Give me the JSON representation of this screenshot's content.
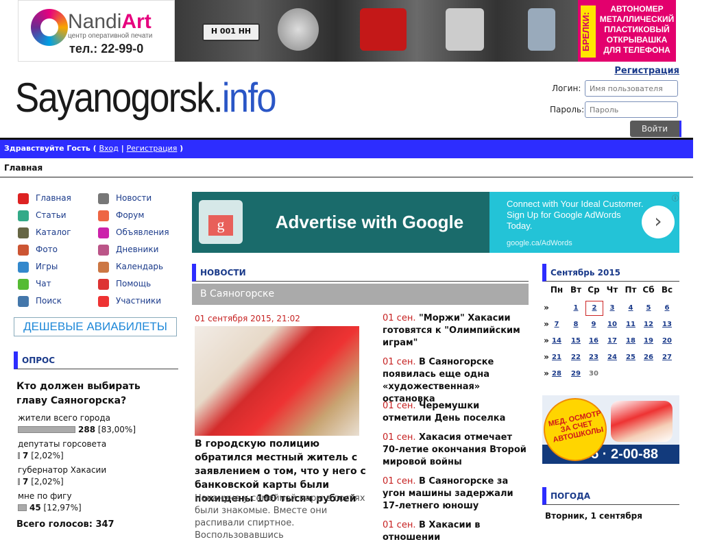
{
  "banner": {
    "brand_name": "Nandi",
    "brand_name_accent": "Art",
    "brand_sub": "центр оперативной печати",
    "brand_tel": "тел.: 22-99-0",
    "plate_text": "Н 001 НН",
    "side_word": "БРЕЛКИ:",
    "side_text": "АВТОНОМЕР МЕТАЛЛИЧЕСКИЙ ПЛАСТИКОВЫЙ ОТКРЫВАШКА ДЛЯ ТЕЛЕФОНА"
  },
  "header": {
    "logo_main": "Sayanogorsk.",
    "logo_accent": "info",
    "register_link": "Регистрация",
    "login_label": "Логин:",
    "login_placeholder": "Имя пользователя",
    "password_label": "Пароль:",
    "password_placeholder": "Пароль",
    "login_button": "Войти"
  },
  "bluebar": {
    "greeting": "Здравствуйте Гость",
    "open_paren": " ( ",
    "login_link": "Вход",
    "sep": " | ",
    "register_link": "Регистрация",
    "close_paren": " )"
  },
  "breadcrumb": "Главная",
  "menu": {
    "left": [
      "Главная",
      "Статьи",
      "Каталог",
      "Фото",
      "Игры",
      "Чат",
      "Поиск"
    ],
    "right": [
      "Новости",
      "Форум",
      "Объявления",
      "Дневники",
      "Календарь",
      "Помощь",
      "Участники"
    ],
    "left_colors": [
      "#d22",
      "#3a8",
      "#664",
      "#c53",
      "#38c",
      "#5b3",
      "#47a"
    ],
    "right_colors": [
      "#777",
      "#e64",
      "#c2a",
      "#b58",
      "#c74",
      "#d33",
      "#e33"
    ]
  },
  "cheap_flights": "ДЕШЕВЫЕ АВИАБИЛЕТЫ",
  "poll": {
    "heading": "ОПРОС",
    "question": "Кто должен выбирать главу Саяногорска?",
    "options": [
      {
        "label": "жители всего города",
        "count": "288",
        "percent": "[83,00%]",
        "share": 0.83
      },
      {
        "label": "депутаты горсовета",
        "count": "7",
        "percent": "[2,02%]",
        "share": 0.0202
      },
      {
        "label": "губернатор Хакасии",
        "count": "7",
        "percent": "[2,02%]",
        "share": 0.0202
      },
      {
        "label": "мне по фигу",
        "count": "45",
        "percent": "[12,97%]",
        "share": 0.1297
      }
    ],
    "total": "Всего голосов: 347"
  },
  "ad": {
    "icon_letter": "g",
    "headline": "Advertise with Google",
    "text": "Connect with Your Ideal Customer. Sign Up for Google AdWords Today.",
    "url": "google.ca/AdWords",
    "arrow": "›",
    "info": "ⓘ"
  },
  "news": {
    "heading": "НОВОСТИ",
    "subheading": "В Саяногорске",
    "lead_date": "01 сентября 2015, 21:02",
    "lead_title": "В городскую полицию обратился местный житель с заявлением о том, что у него с банковской карты были похищены 100 тысяч рублей",
    "lead_excerpt": "Накануне у семейной пары в гостях были знакомые. Вместе они распивали спиртное. Воспользовавшись",
    "items": [
      {
        "date": "01 сен.",
        "title": "\"Моржи\" Хакасии готовятся к \"Олимпийским играм\""
      },
      {
        "date": "01 сен.",
        "title": "В Саяногорске появилась еще одна «художественная» остановка"
      },
      {
        "date": "01 сен.",
        "title": "Черемушки отметили День поселка"
      },
      {
        "date": "01 сен.",
        "title": "Хакасия отмечает 70-летие окончания Второй мировой войны"
      },
      {
        "date": "01 сен.",
        "title": "В Саяногорске за угон машины задержали 17-летнего юношу"
      },
      {
        "date": "01 сен.",
        "title": "В Хакасии в отношении"
      }
    ]
  },
  "calendar": {
    "title": "Сентябрь 2015",
    "weekdays": [
      "Пн",
      "Вт",
      "Ср",
      "Чт",
      "Пт",
      "Сб",
      "Вс"
    ],
    "week_marker": "»",
    "weeks": [
      [
        "",
        "1",
        "2",
        "3",
        "4",
        "5",
        "6"
      ],
      [
        "7",
        "8",
        "9",
        "10",
        "11",
        "12",
        "13"
      ],
      [
        "14",
        "15",
        "16",
        "17",
        "18",
        "19",
        "20"
      ],
      [
        "21",
        "22",
        "23",
        "24",
        "25",
        "26",
        "27"
      ],
      [
        "28",
        "29",
        "30",
        "",
        "",
        "",
        ""
      ]
    ],
    "today": "2"
  },
  "med_banner": {
    "circle_text": "МЕД. ОСМОТР ЗА СЧЕТ АВТОШКОЛЫ",
    "phone": "55 · 2-00-88"
  },
  "weather": {
    "heading": "ПОГОДА",
    "day": "Вторник, 1 сентября"
  }
}
